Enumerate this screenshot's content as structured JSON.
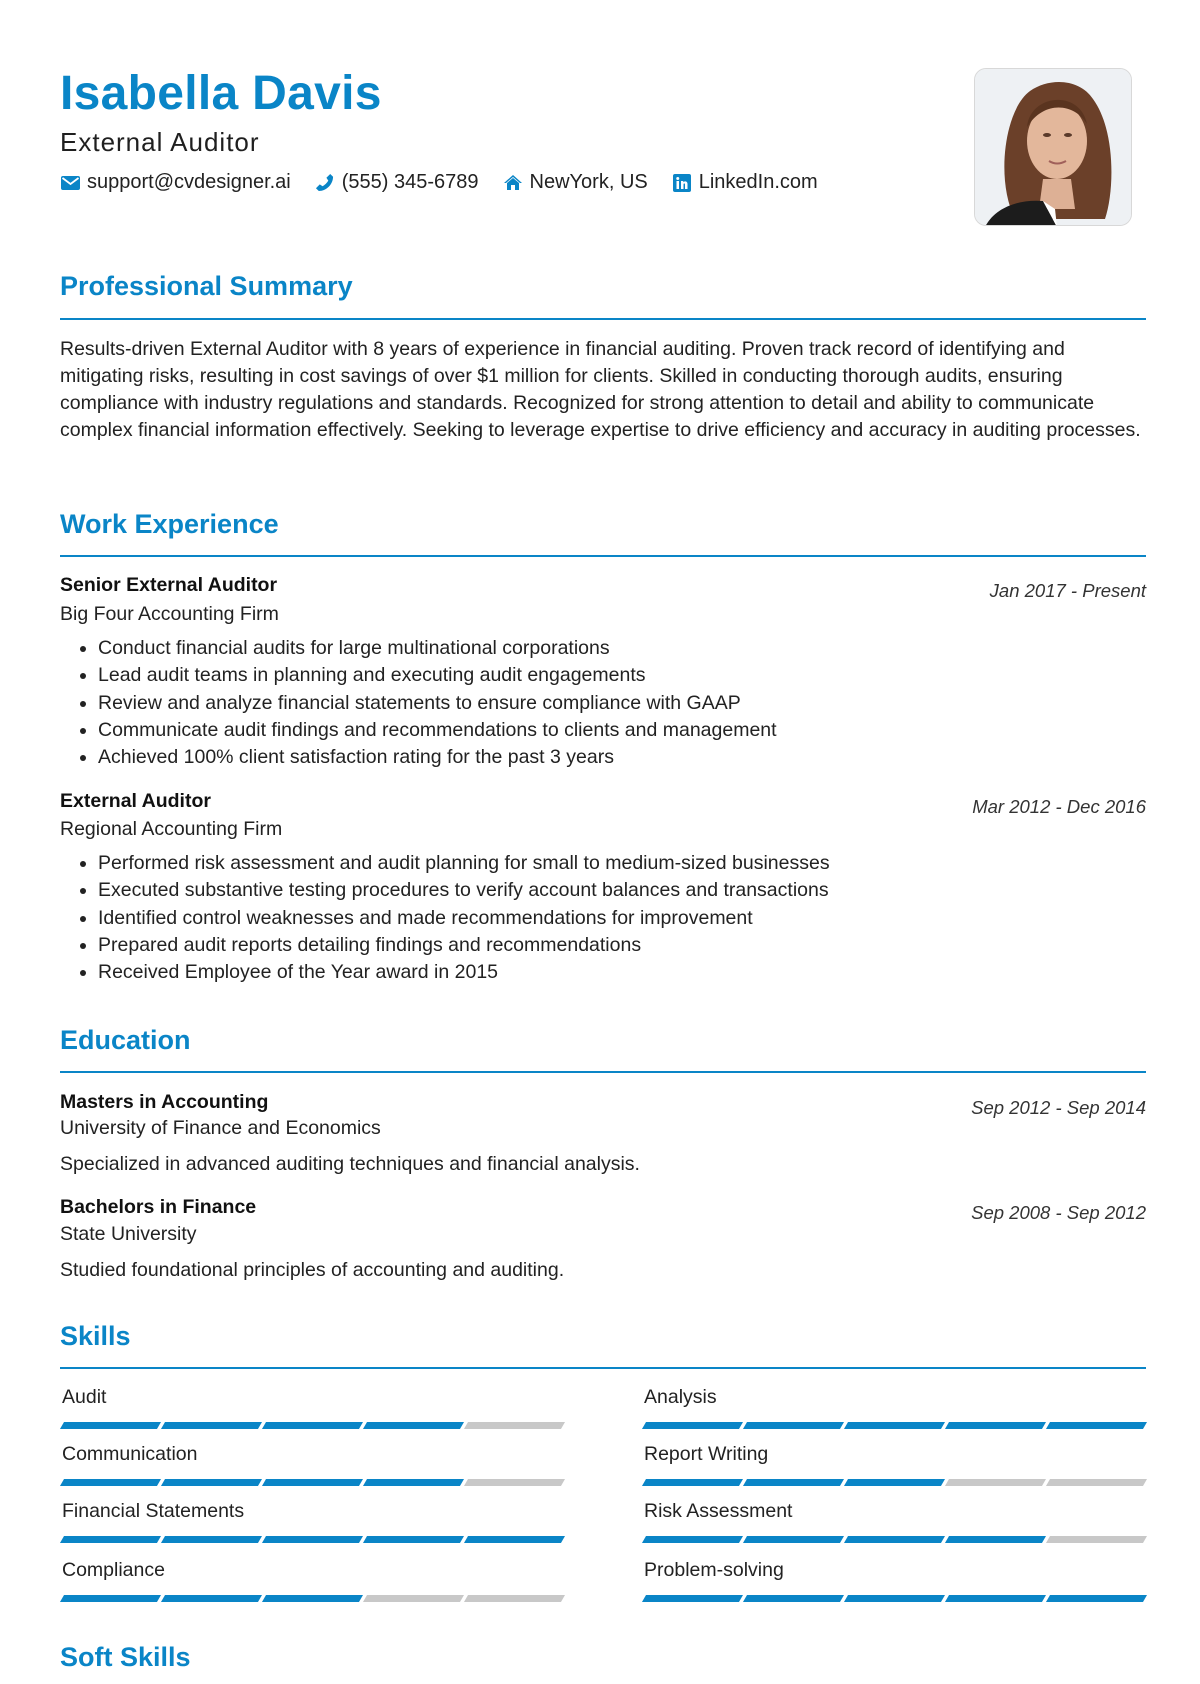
{
  "header": {
    "name": "Isabella Davis",
    "title": "External Auditor",
    "contacts": [
      {
        "icon": "envelope-icon",
        "text": "support@cvdesigner.ai"
      },
      {
        "icon": "phone-icon",
        "text": "(555) 345-6789"
      },
      {
        "icon": "home-icon",
        "text": "NewYork, US"
      },
      {
        "icon": "linkedin-icon",
        "text": "LinkedIn.com"
      }
    ],
    "photo_alt": "Profile photo of Isabella Davis"
  },
  "colors": {
    "accent": "#0a85c7",
    "bar_empty": "#c8c8c8",
    "text": "#222222"
  },
  "summary": {
    "heading": "Professional Summary",
    "text": "Results-driven External Auditor with 8 years of experience in financial auditing. Proven track record of identifying and mitigating risks, resulting in cost savings of over $1 million for clients. Skilled in conducting thorough audits, ensuring compliance with industry regulations and standards. Recognized for strong attention to detail and ability to communicate complex financial information effectively. Seeking to leverage expertise to drive efficiency and accuracy in auditing processes."
  },
  "experience": {
    "heading": "Work Experience",
    "jobs": [
      {
        "title": "Senior External Auditor",
        "company": "Big Four Accounting Firm",
        "dates": "Jan 2017 - Present",
        "bullets": [
          "Conduct financial audits for large multinational corporations",
          "Lead audit teams in planning and executing audit engagements",
          "Review and analyze financial statements to ensure compliance with GAAP",
          "Communicate audit findings and recommendations to clients and management",
          "Achieved 100% client satisfaction rating for the past 3 years"
        ]
      },
      {
        "title": "External Auditor",
        "company": "Regional Accounting Firm",
        "dates": "Mar 2012 - Dec 2016",
        "bullets": [
          "Performed risk assessment and audit planning for small to medium-sized businesses",
          "Executed substantive testing procedures to verify account balances and transactions",
          "Identified control weaknesses and made recommendations for improvement",
          "Prepared audit reports detailing findings and recommendations",
          "Received Employee of the Year award in 2015"
        ]
      }
    ]
  },
  "education": {
    "heading": "Education",
    "items": [
      {
        "degree": "Masters in Accounting",
        "school": "University of Finance and Economics",
        "dates": "Sep 2012 - Sep 2014",
        "description": "Specialized in advanced auditing techniques and financial analysis."
      },
      {
        "degree": "Bachelors in Finance",
        "school": "State University",
        "dates": "Sep 2008 - Sep 2012",
        "description": "Studied foundational principles of accounting and auditing."
      }
    ]
  },
  "skills": {
    "heading": "Skills",
    "max_level": 5,
    "items": [
      {
        "name": "Audit",
        "level": 4
      },
      {
        "name": "Analysis",
        "level": 5
      },
      {
        "name": "Communication",
        "level": 4
      },
      {
        "name": "Report Writing",
        "level": 3
      },
      {
        "name": "Financial Statements",
        "level": 5
      },
      {
        "name": "Risk Assessment",
        "level": 4
      },
      {
        "name": "Compliance",
        "level": 3
      },
      {
        "name": "Problem-solving",
        "level": 5
      }
    ]
  },
  "soft_skills": {
    "heading": "Soft Skills"
  }
}
